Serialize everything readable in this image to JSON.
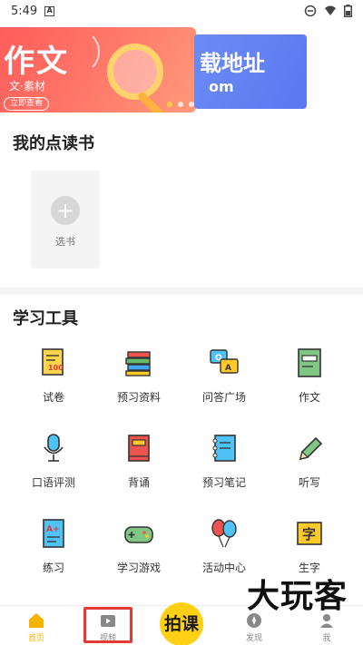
{
  "status_bar": {
    "time": "5:49",
    "notif_icon": "a-square-icon",
    "icons": [
      "dnd-icon",
      "wifi-icon",
      "battery-icon"
    ]
  },
  "banner": {
    "main_title": "作文",
    "main_sub": "文·素材",
    "main_button": "立即查看",
    "next_title": "载地址",
    "next_sub": "om",
    "active_index": 0,
    "dot_count": 3
  },
  "my_books": {
    "title": "我的点读书",
    "select_label": "选书"
  },
  "tools": {
    "title": "学习工具",
    "items": [
      {
        "label": "试卷",
        "icon": "exam-paper-icon"
      },
      {
        "label": "预习资料",
        "icon": "book-stack-icon"
      },
      {
        "label": "问答广场",
        "icon": "qa-chat-icon"
      },
      {
        "label": "作文",
        "icon": "composition-book-icon"
      },
      {
        "label": "口语评测",
        "icon": "microphone-icon"
      },
      {
        "label": "背诵",
        "icon": "recite-book-icon"
      },
      {
        "label": "预习笔记",
        "icon": "notebook-icon"
      },
      {
        "label": "听写",
        "icon": "pencil-icon"
      },
      {
        "label": "练习",
        "icon": "practice-paper-icon"
      },
      {
        "label": "学习游戏",
        "icon": "gamepad-icon"
      },
      {
        "label": "活动中心",
        "icon": "balloons-icon"
      },
      {
        "label": "生字",
        "icon": "character-card-icon"
      }
    ]
  },
  "bottom_nav": {
    "items": [
      {
        "label": "首页",
        "icon": "home-icon",
        "active": true
      },
      {
        "label": "视频",
        "icon": "video-icon",
        "active": false
      },
      {
        "label": "拍课",
        "icon": "camera-lesson-icon",
        "active": false
      },
      {
        "label": "发现",
        "icon": "discover-icon",
        "active": false
      },
      {
        "label": "我",
        "icon": "profile-icon",
        "active": false
      }
    ],
    "center_text": "拍课"
  },
  "watermark": "大玩客",
  "colors": {
    "accent_yellow": "#ffd015",
    "highlight_red": "#e53935"
  }
}
